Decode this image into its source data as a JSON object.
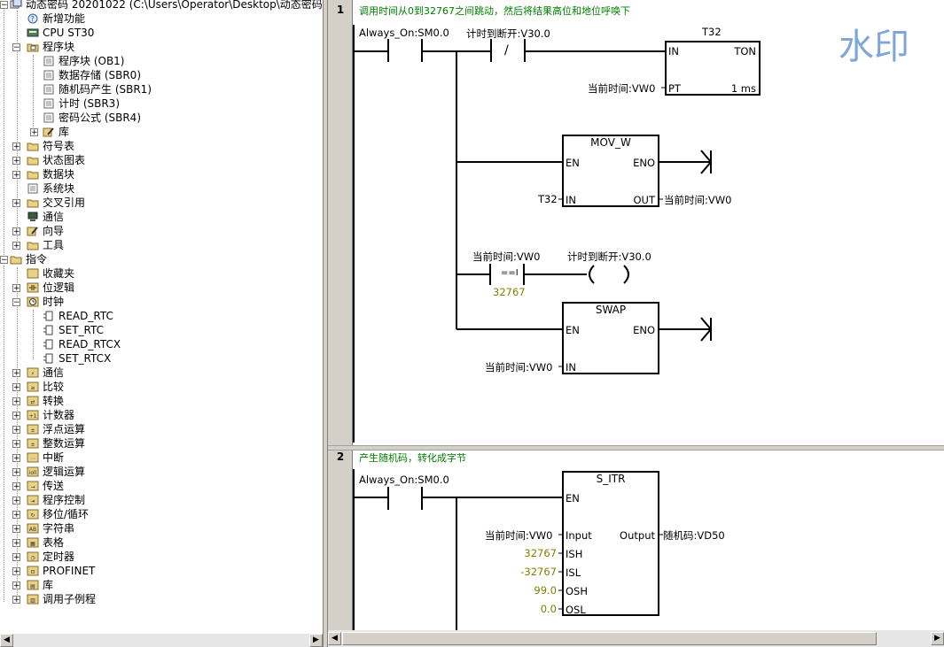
{
  "tree": {
    "root": "动态密码 20201022 (C:\\Users\\Operator\\Desktop\\动态密码 2020102",
    "items": [
      "新增功能",
      "CPU ST30",
      "程序块",
      "程序块 (OB1)",
      "数据存储 (SBR0)",
      "随机码产生 (SBR1)",
      "计时 (SBR3)",
      "密码公式 (SBR4)",
      "库",
      "符号表",
      "状态图表",
      "数据块",
      "系统块",
      "交叉引用",
      "通信",
      "向导",
      "工具"
    ],
    "instructions_root": "指令",
    "instructions": [
      "收藏夹",
      "位逻辑",
      "时钟",
      "READ_RTC",
      "SET_RTC",
      "READ_RTCX",
      "SET_RTCX",
      "通信",
      "比较",
      "转换",
      "计数器",
      "浮点运算",
      "整数运算",
      "中断",
      "逻辑运算",
      "传送",
      "程序控制",
      "移位/循环",
      "字符串",
      "表格",
      "定时器",
      "PROFINET",
      "库",
      "调用子例程"
    ]
  },
  "watermark": "水印",
  "network1": {
    "number": "1",
    "comment": "调用时间从0到32767之间跳动，然后将结果高位和地位呼唤下",
    "contact1": "Always_On:SM0.0",
    "contact2": "计时到断开:V30.0",
    "contact2_symbol": "/",
    "timer": {
      "name": "T32",
      "in": "IN",
      "type": "TON",
      "pt": "PT",
      "pt_var": "当前时间:VW0",
      "res": "1 ms"
    },
    "mov": {
      "title": "MOV_W",
      "en": "EN",
      "eno": "ENO",
      "in": "IN",
      "out": "OUT",
      "in_var": "T32",
      "out_var": "当前时间:VW0"
    },
    "compare": {
      "var": "当前时间:VW0",
      "op": "==I",
      "value": "32767",
      "coil": "计时到断开:V30.0"
    },
    "swap": {
      "title": "SWAP",
      "en": "EN",
      "eno": "ENO",
      "in": "IN",
      "in_var": "当前时间:VW0"
    }
  },
  "network2": {
    "number": "2",
    "comment": "产生随机码，转化成字节",
    "contact1": "Always_On:SM0.0",
    "sitr": {
      "title": "S_ITR",
      "en": "EN",
      "input": "Input",
      "output": "Output",
      "input_var": "当前时间:VW0",
      "output_var": "随机码:VD50",
      "ish": "ISH",
      "ish_val": "32767",
      "isl": "ISL",
      "isl_val": "-32767",
      "osh": "OSH",
      "osh_val": "99.0",
      "osl": "OSL",
      "osl_val": "0.0"
    }
  }
}
